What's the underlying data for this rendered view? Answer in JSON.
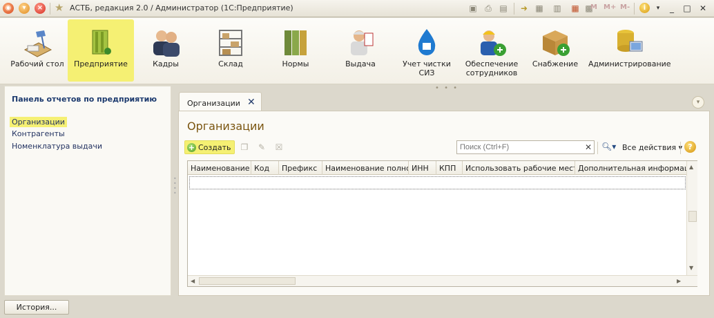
{
  "window": {
    "title": "АСТБ, редакция 2.0 / Администратор  (1С:Предприятие)",
    "mem_buttons": [
      "M",
      "M+",
      "M-"
    ]
  },
  "sections": [
    {
      "label": "Рабочий стол",
      "icon": "desk-lamp-icon"
    },
    {
      "label": "Предприятие",
      "icon": "enterprise-building-icon",
      "active": true
    },
    {
      "label": "Кадры",
      "icon": "staff-people-icon"
    },
    {
      "label": "Склад",
      "icon": "warehouse-shelf-icon"
    },
    {
      "label": "Нормы",
      "icon": "norms-binders-icon"
    },
    {
      "label": "Выдача",
      "icon": "issue-worker-icon"
    },
    {
      "label": "Учет чистки СИЗ",
      "icon": "cleaning-drop-icon"
    },
    {
      "label": "Обеспечение сотрудников",
      "icon": "supply-employee-icon"
    },
    {
      "label": "Снабжение",
      "icon": "procurement-box-icon"
    },
    {
      "label": "Администрирование",
      "icon": "administration-db-icon"
    }
  ],
  "left_panel": {
    "title": "Панель отчетов по предприятию",
    "links": [
      "Организации",
      "Контрагенты",
      "Номенклатура выдачи"
    ],
    "active_link": "Организации"
  },
  "tab": {
    "label": "Организации"
  },
  "form": {
    "title": "Организации",
    "create_label": "Создать",
    "search_placeholder": "Поиск (Ctrl+F)",
    "actions_label": "Все действия",
    "columns": [
      "Наименование",
      "Код",
      "Префикс",
      "Наименование полное",
      "ИНН",
      "КПП",
      "Использовать рабочие места",
      "Дополнительная информация"
    ],
    "rows": []
  },
  "footer": {
    "history_label": "История..."
  },
  "colors": {
    "highlight": "#f5f073",
    "title": "#7a5510",
    "link": "#1f2f5f"
  }
}
